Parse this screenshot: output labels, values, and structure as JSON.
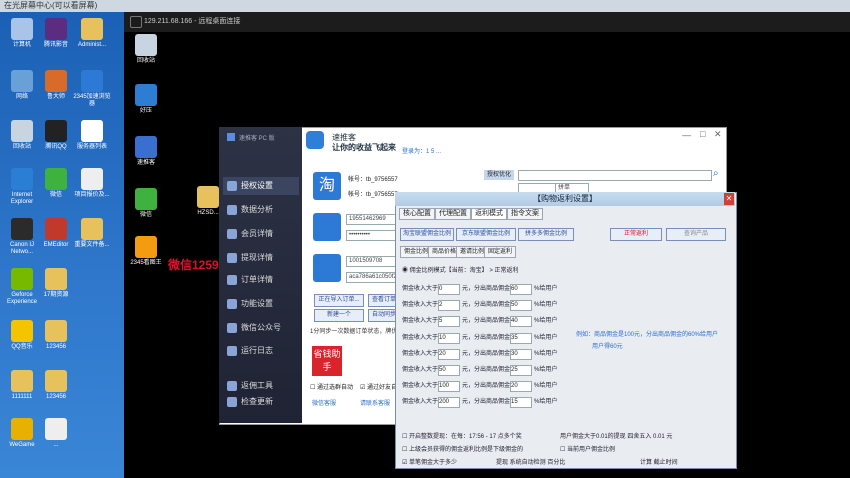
{
  "local_title": "在光屏幕中心(可以看屏幕)",
  "remote_title": "129.211.68.166 - 远程桌面连接",
  "local_icons": [
    {
      "label": "计算机",
      "color": "#a9c4e6"
    },
    {
      "label": "腾讯影音",
      "color": "#5b2c7f"
    },
    {
      "label": "Administ...",
      "color": "#e7c25c"
    },
    {
      "label": "网络",
      "color": "#6aa0d8"
    },
    {
      "label": "鲁大师",
      "color": "#d86b2a"
    },
    {
      "label": "2345加速浏览器",
      "color": "#2c7ad6"
    },
    {
      "label": "回收站",
      "color": "#c8d4e0"
    },
    {
      "label": "腾讯QQ",
      "color": "#222"
    },
    {
      "label": "服务器列表",
      "color": "#fff"
    },
    {
      "label": "Internet Explorer",
      "color": "#2a7fd4"
    },
    {
      "label": "微信",
      "color": "#3fb13f"
    },
    {
      "label": "项目报价及...",
      "color": "#eee"
    },
    {
      "label": "Canon IJ Netwo...",
      "color": "#2b2b2b"
    },
    {
      "label": "EMEditor",
      "color": "#c0392b"
    },
    {
      "label": "重要文件备...",
      "color": "#e7c25c"
    },
    {
      "label": "Geforce Experience",
      "color": "#76b900"
    },
    {
      "label": "17期资源",
      "color": "#e7c25c"
    },
    {
      "label": "QQ音乐",
      "color": "#f5c400"
    },
    {
      "label": "123456",
      "color": "#e7c25c"
    },
    {
      "label": "1111111",
      "color": "#e7c25c"
    },
    {
      "label": "123456",
      "color": "#e7c25c"
    },
    {
      "label": "WeGame",
      "color": "#e8b000"
    },
    {
      "label": "...",
      "color": "#eee"
    }
  ],
  "remote_icons": [
    {
      "label": "回收站",
      "color": "#c8d4e0"
    },
    {
      "label": "好压",
      "color": "#2d7dd2"
    },
    {
      "label": "速推客",
      "color": "#3a6fd0"
    },
    {
      "label": "微信",
      "color": "#3fb13f"
    },
    {
      "label": "2345看图王",
      "color": "#f39c12"
    },
    {
      "label": "HZSD...",
      "color": "#e7c25c"
    }
  ],
  "watermark": "微信1259651513",
  "app": {
    "logo_title": "速推客",
    "slogan": "让你的收益飞起来",
    "login_text": "登录为：1 5 ...",
    "nav": [
      {
        "label": "授权设置",
        "active": true
      },
      {
        "label": "数据分析"
      },
      {
        "label": "会员详情"
      },
      {
        "label": "提现详情"
      },
      {
        "label": "订单详情"
      },
      {
        "label": "功能设置"
      },
      {
        "label": "微信公众号"
      },
      {
        "label": "运行日志"
      },
      {
        "label": "返佣工具"
      },
      {
        "label": "检查更新"
      }
    ],
    "side_header": "速推客 PC 版",
    "account1": "帐号：tb_9756557",
    "account2": "帐号：tb_9756557",
    "phone": "19551462969",
    "password": "••••••••••",
    "id3": "1001509708",
    "key": "aca786a61c050f2a1...",
    "btn_import": "正在导入订单...",
    "btn_query": "查看订单",
    "btn_new": "新建一个",
    "btn_stat": "自动同步",
    "note": "1分同步一次数据订单状态，牌优先",
    "bottom_text": "微信客服",
    "bottom_text2": "请联系客服",
    "helper": "省钱助手",
    "cb1": "通过选群自动",
    "cb2": "通过好友自动",
    "label_tb": "授权优化",
    "label_pid": "PID",
    "search_hint": "拼单"
  },
  "dialog": {
    "title": "【购物返利设置】",
    "tabs": [
      "核心配置",
      "代理配置",
      "返利模式",
      "指令文案"
    ],
    "active_tab": "返利模式",
    "mode_btns": [
      "淘宝联盟佣金比例",
      "京东联盟佣金比例",
      "拼多多佣金比例"
    ],
    "red_label": "正常返利",
    "gray_label": "查询产品",
    "sub_tabs": [
      "佣金比例",
      "商品价格",
      "邀请比例",
      "固定返利"
    ],
    "radio_label": "佣金比例模式【当前：淘宝】 > 正常返利",
    "rows": [
      {
        "a": "佣金收入大于",
        "v": "0",
        "b": "元，分出商品佣金的",
        "p": "60",
        "c": "%给用户"
      },
      {
        "a": "佣金收入大于",
        "v": "2",
        "b": "元，分出商品佣金的",
        "p": "50",
        "c": "%给用户"
      },
      {
        "a": "佣金收入大于",
        "v": "5",
        "b": "元，分出商品佣金的",
        "p": "40",
        "c": "%给用户"
      },
      {
        "a": "佣金收入大于",
        "v": "10",
        "b": "元，分出商品佣金的",
        "p": "35",
        "c": "%给用户"
      },
      {
        "a": "佣金收入大于",
        "v": "20",
        "b": "元，分出商品佣金的",
        "p": "30",
        "c": "%给用户"
      },
      {
        "a": "佣金收入大于",
        "v": "50",
        "b": "元，分出商品佣金的",
        "p": "25",
        "c": "%给用户"
      },
      {
        "a": "佣金收入大于",
        "v": "100",
        "b": "元，分出商品佣金的",
        "p": "20",
        "c": "%给用户"
      },
      {
        "a": "佣金收入大于",
        "v": "200",
        "b": "元，分出商品佣金的",
        "p": "15",
        "c": "%给用户"
      }
    ],
    "example1": "例如：商品佣金是100元，分出商品佣金的60%给用户",
    "example2": "用户得60元",
    "opt1": "开启整数提现：在每：17:56 - 17 点多个奖",
    "opt1b": "用户佣金大于0.01的提现 四舍五入 0.01 元",
    "opt2": "上级会员获得的佣金返利比例是下级佣金的",
    "opt2b": "当前用户佣金比例",
    "opt3": "单笔佣金大于多少",
    "opt3b": "提现 系统自动检测 百分比",
    "opt3c": "计算 截止时间"
  }
}
